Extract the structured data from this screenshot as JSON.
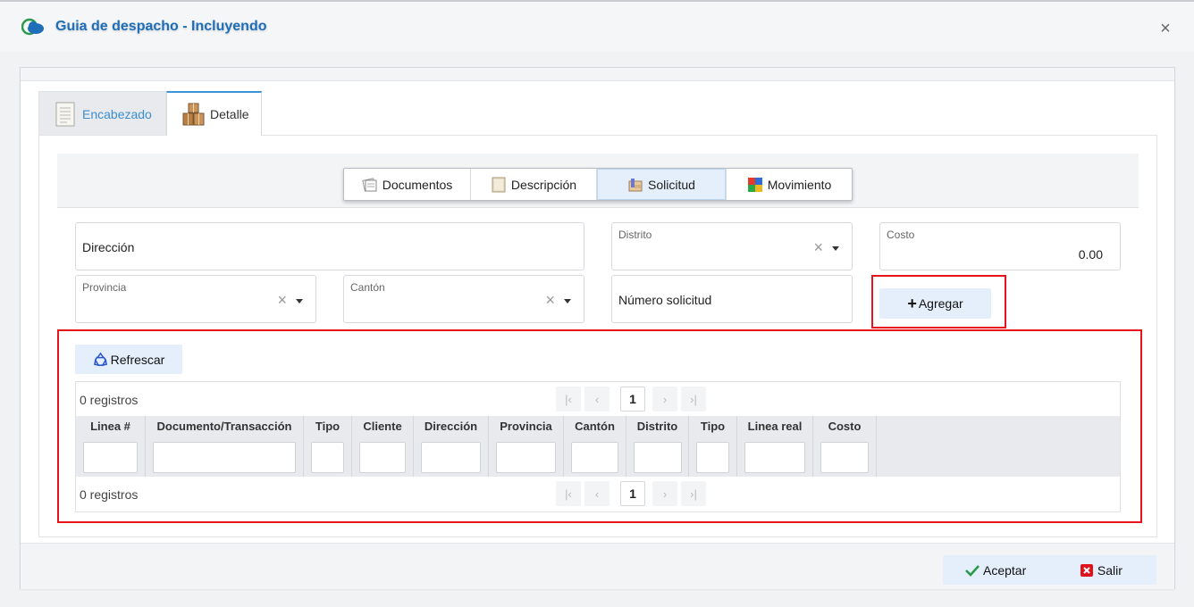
{
  "window": {
    "title": "Guia de despacho - Incluyendo"
  },
  "tabs": [
    {
      "label": "Encabezado",
      "icon": "document-icon"
    },
    {
      "label": "Detalle",
      "icon": "boxes-icon"
    }
  ],
  "subtabs": [
    {
      "label": "Documentos",
      "icon": "documents-icon"
    },
    {
      "label": "Descripción",
      "icon": "description-icon"
    },
    {
      "label": "Solicitud",
      "icon": "request-icon",
      "active": true
    },
    {
      "label": "Movimiento",
      "icon": "movement-icon"
    }
  ],
  "form": {
    "direccion": {
      "placeholder": "Dirección"
    },
    "distrito": {
      "label": "Distrito"
    },
    "costo": {
      "label": "Costo",
      "value": "0.00"
    },
    "provincia": {
      "label": "Provincia"
    },
    "canton": {
      "label": "Cantón"
    },
    "numero_solicitud": {
      "placeholder": "Número solicitud"
    },
    "agregar_label": "Agregar"
  },
  "grid": {
    "refresh_label": "Refrescar",
    "top_count": "0 registros",
    "bottom_count": "0 registros",
    "page": "1",
    "columns": [
      "Linea #",
      "Documento/Transacción",
      "Tipo",
      "Cliente",
      "Dirección",
      "Provincia",
      "Cantón",
      "Distrito",
      "Tipo",
      "Linea real",
      "Costo"
    ]
  },
  "footer": {
    "accept_label": "Aceptar",
    "exit_label": "Salir"
  },
  "colors": {
    "accent": "#1e6fb8",
    "highlight_box": "#e8141c",
    "button_bg": "#e4effb"
  }
}
